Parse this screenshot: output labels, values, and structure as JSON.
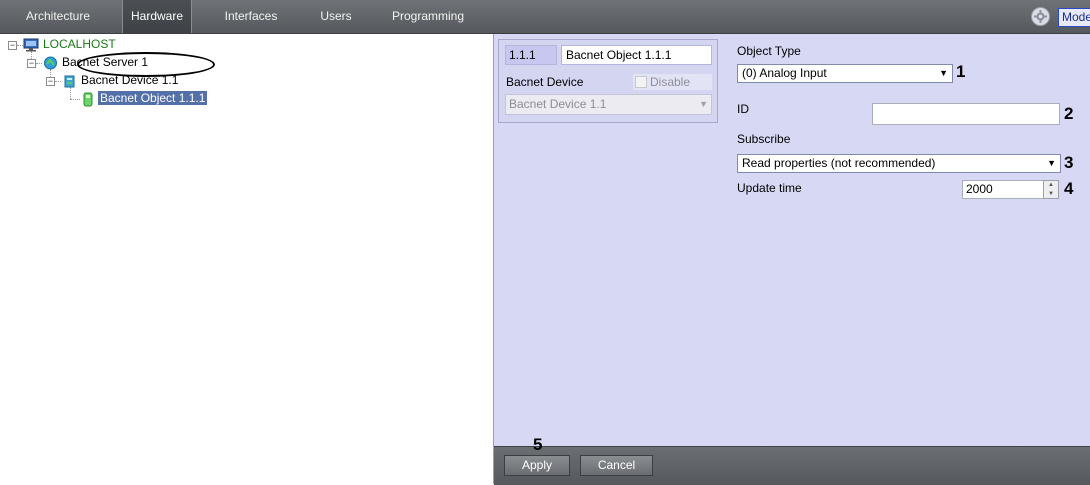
{
  "topbar": {
    "tabs": [
      {
        "label": "Architecture"
      },
      {
        "label": "Hardware"
      },
      {
        "label": "Interfaces"
      },
      {
        "label": "Users"
      },
      {
        "label": "Programming"
      }
    ],
    "active_tab": "Hardware",
    "mode_label": "Mode"
  },
  "tree": {
    "host": "LOCALHOST",
    "server": "Bacnet Server 1",
    "device": "Bacnet Device 1.1",
    "object": "Bacnet Object 1.1.1"
  },
  "card": {
    "id_value": "1.1.1",
    "name_value": "Bacnet Object 1.1.1",
    "device_label": "Bacnet Device",
    "disable_label": "Disable",
    "device_value": "Bacnet Device 1.1"
  },
  "form": {
    "object_type_label": "Object Type",
    "object_type_value": "(0) Analog Input",
    "id_label": "ID",
    "id_value": "",
    "subscribe_label": "Subscribe",
    "subscribe_value": "Read properties (not recommended)",
    "update_time_label": "Update time",
    "update_time_value": "2000"
  },
  "annotations": {
    "n1": "1",
    "n2": "2",
    "n3": "3",
    "n4": "4",
    "n5": "5"
  },
  "buttons": {
    "apply": "Apply",
    "cancel": "Cancel"
  },
  "colors": {
    "panel_bg": "#d7d8f3",
    "topbar": "#5f6367",
    "selection": "#5470a8",
    "host_text": "#1a7a1a"
  }
}
